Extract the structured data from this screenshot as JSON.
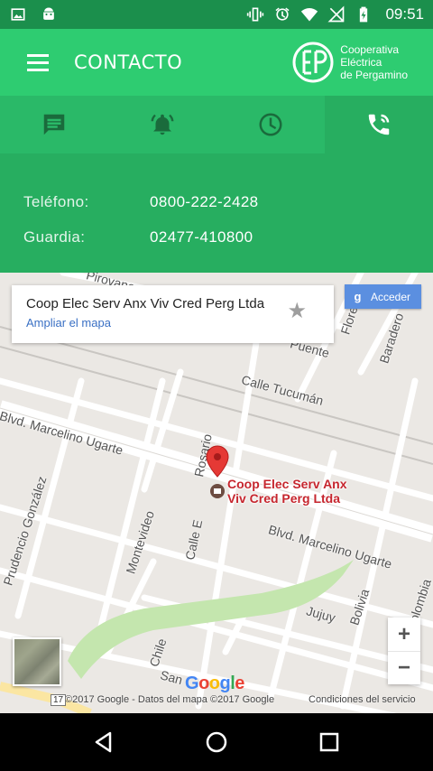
{
  "status_bar": {
    "time": "09:51",
    "left_icons": [
      "image-icon",
      "android-icon"
    ],
    "right_icons": [
      "vibrate-icon",
      "alarm-icon",
      "wifi-icon",
      "no-signal-icon",
      "battery-charging-icon"
    ]
  },
  "app_bar": {
    "title": "CONTACTO",
    "logo_text": [
      "Cooperativa",
      "Eléctrica",
      "de Pergamino"
    ],
    "colors": {
      "primary": "#2ecc71",
      "status": "#1b8f4c",
      "panel": "#27ae60"
    }
  },
  "tabs": [
    {
      "icon": "chat-icon",
      "active": false
    },
    {
      "icon": "alarm-bell-icon",
      "active": false
    },
    {
      "icon": "clock-icon",
      "active": false
    },
    {
      "icon": "phone-call-icon",
      "active": true
    }
  ],
  "contact": {
    "rows": [
      {
        "label": "Teléfono:",
        "value": "0800-222-2428"
      },
      {
        "label": "Guardia:",
        "value": "02477-410800"
      }
    ]
  },
  "map": {
    "info_card": {
      "title": "Coop Elec Serv Anx Viv Cred Perg Ltda",
      "link": "Ampliar el mapa"
    },
    "login_button": "Acceder",
    "marker_label": [
      "Coop Elec Serv Anx",
      "Viv Cred Perg Ltda"
    ],
    "street_labels": [
      "Calle Tucumán",
      "Blvd. Marcelino Ugarte",
      "Blvd. Marcelino Ugarte",
      "Prudencio González",
      "Montevideo",
      "Calle E",
      "Rosario",
      "Jujuy",
      "Bolivia",
      "Chile",
      "San",
      "Colombia",
      "Baradero",
      "Florencio",
      "Puente",
      "Pirovano"
    ],
    "zoom_in": "+",
    "zoom_out": "−",
    "attribution": "©2017 Google - Datos del mapa ©2017 Google",
    "terms": "Condiciones del servicio",
    "route_shield": "17"
  },
  "nav_bar": {
    "buttons": [
      "back-icon",
      "home-icon",
      "recents-icon"
    ]
  }
}
